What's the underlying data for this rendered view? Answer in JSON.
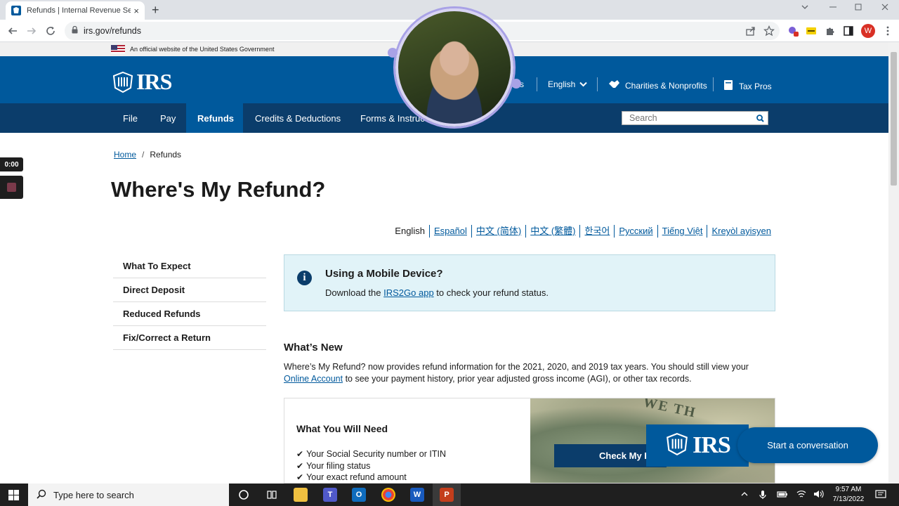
{
  "browser": {
    "tab_title": "Refunds | Internal Revenue Servi",
    "tab_close": "×",
    "new_tab": "+",
    "url": "irs.gov/refunds",
    "profile_initial": "W"
  },
  "gov_banner": "An official website of the United States Government",
  "header": {
    "logo_text": "IRS",
    "util_nav": {
      "partial": "s",
      "language": "English",
      "charities": "Charities & Nonprofits",
      "tax_pros": "Tax Pros"
    },
    "nav": [
      {
        "label": "File"
      },
      {
        "label": "Pay"
      },
      {
        "label": "Refunds"
      },
      {
        "label": "Credits & Deductions"
      },
      {
        "label": "Forms & Instruc"
      }
    ],
    "search_placeholder": "Search"
  },
  "breadcrumb": {
    "home": "Home",
    "sep": "/",
    "current": "Refunds"
  },
  "page_title": "Where's My Refund?",
  "languages": [
    "English",
    "Español",
    "中文 (简体)",
    "中文 (繁體)",
    "한국어",
    "Русский",
    "Tiếng Việt",
    "Kreyòl ayisyen"
  ],
  "sidenav": [
    "What To Expect",
    "Direct Deposit",
    "Reduced Refunds",
    "Fix/Correct a Return"
  ],
  "mobile": {
    "title": "Using a Mobile Device?",
    "text_before": "Download the ",
    "link": "IRS2Go app",
    "text_after": " to check your refund status."
  },
  "whats_new": {
    "heading": "What’s New",
    "text_before": "Where’s My Refund? now provides refund information for the 2021, 2020, and 2019 tax years. You should still view your ",
    "link": "Online Account",
    "text_after": " to see your payment history, prior year adjusted gross income (AGI), or other tax records."
  },
  "need": {
    "heading": "What You Will Need",
    "items": [
      "Your Social Security number or ITIN",
      "Your filing status",
      "Your exact refund amount"
    ],
    "bill_text": "WE TH"
  },
  "check_button": "Check My R",
  "chat": {
    "logo_text": "IRS",
    "button": "Start a conversation"
  },
  "recorder": {
    "time": "0:00"
  },
  "taskbar": {
    "search_placeholder": "Type here to search",
    "time": "9:57 AM",
    "date": "7/13/2022"
  },
  "colors": {
    "irs_blue": "#00599c",
    "irs_navy": "#0b3d6b",
    "info_bg": "#e1f3f8"
  }
}
